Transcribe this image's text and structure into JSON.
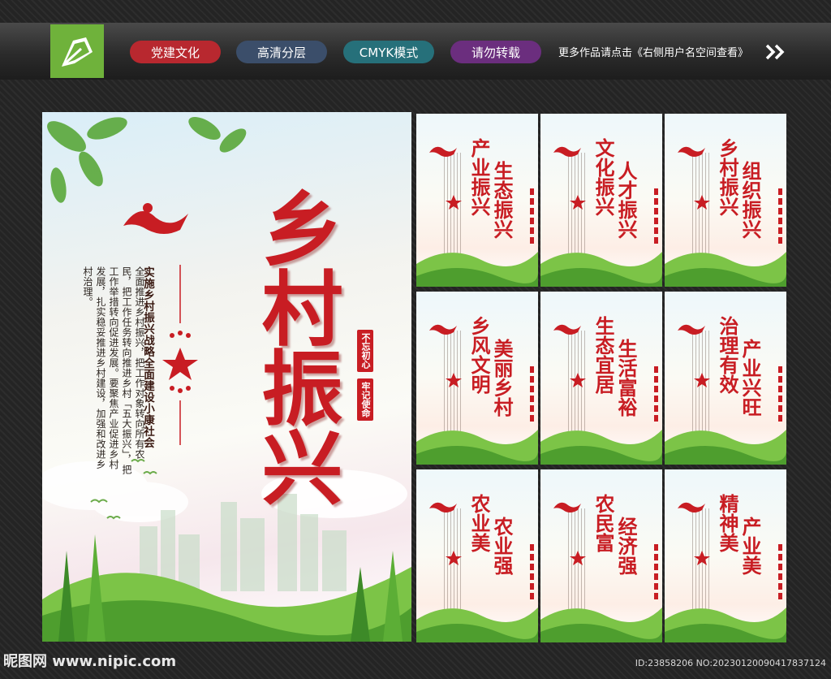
{
  "topbar": {
    "tags": [
      {
        "label": "党建文化",
        "color": "#b8282f"
      },
      {
        "label": "高清分层",
        "color": "#3b4e6a"
      },
      {
        "label": "CMYK模式",
        "color": "#26707a"
      },
      {
        "label": "请勿转载",
        "color": "#6b2e7e"
      }
    ],
    "more_link": "更多作品请点击《右侧用户名空间查看》"
  },
  "main_poster": {
    "title": "乡村振兴",
    "subtitle": "实施乡村振兴战略全面建设小康社会",
    "body": "全面推进乡村振兴，把工作对象转向所有农民，把工作任务转向推进乡村「五大振兴」，把工作举措转向促进发展。要聚焦产业促进乡村发展，扎实稳妥推进乡村建设，加强和改进乡村治理。",
    "seal_1": "不忘初心",
    "seal_2": "牢记使命",
    "accent": "#c81d23"
  },
  "small_posters": [
    {
      "line1": "产业振兴",
      "line2": "生态振兴"
    },
    {
      "line1": "文化振兴",
      "line2": "人才振兴"
    },
    {
      "line1": "乡村振兴",
      "line2": "组织振兴"
    },
    {
      "line1": "乡风文明",
      "line2": "美丽乡村"
    },
    {
      "line1": "生态宜居",
      "line2": "生活富裕"
    },
    {
      "line1": "治理有效",
      "line2": "产业兴旺"
    },
    {
      "line1": "农业美",
      "line2": "农业强"
    },
    {
      "line1": "农民富",
      "line2": "经济强"
    },
    {
      "line1": "精神美",
      "line2": "产业美"
    }
  ],
  "footer": {
    "watermark": "昵图网 www.nipic.com",
    "id_text": "ID:23858206 NO:20230120090417837124"
  }
}
